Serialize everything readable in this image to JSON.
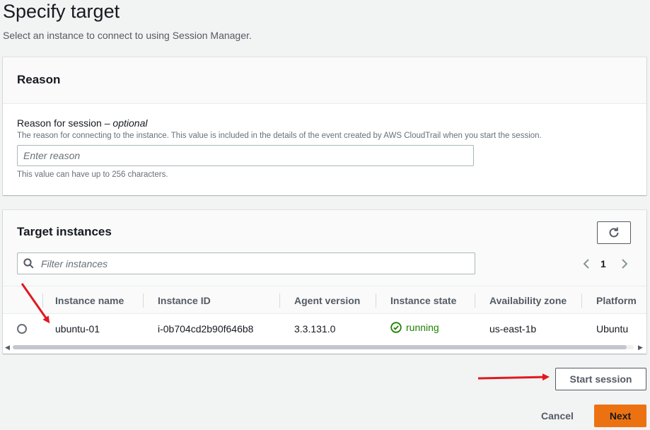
{
  "header": {
    "title": "Specify target",
    "subtitle": "Select an instance to connect to using Session Manager."
  },
  "reason": {
    "title": "Reason",
    "label": "Reason for session",
    "label_separator": " – ",
    "label_optional": "optional",
    "description": "The reason for connecting to the instance. This value is included in the details of the event created by AWS CloudTrail when you start the session.",
    "placeholder": "Enter reason",
    "value": "",
    "constraint": "This value can have up to 256 characters."
  },
  "targets": {
    "title": "Target instances",
    "refresh_icon": "refresh-icon",
    "filter_placeholder": "Filter instances",
    "pagination": {
      "current_page": "1"
    },
    "columns": [
      "Instance name",
      "Instance ID",
      "Agent version",
      "Instance state",
      "Availability zone",
      "Platform"
    ],
    "rows": [
      {
        "name": "ubuntu-01",
        "id": "i-0b704cd2b90f646b8",
        "agent_version": "3.3.131.0",
        "state": "running",
        "availability_zone": "us-east-1b",
        "platform": "Ubuntu",
        "selected": false
      }
    ]
  },
  "actions": {
    "start_session": "Start session",
    "cancel": "Cancel",
    "next": "Next"
  },
  "colors": {
    "primary_button": "#ec7211",
    "running_status": "#1d8102",
    "annotation_arrow": "#e0191f",
    "page_background": "#f2f3f3"
  }
}
